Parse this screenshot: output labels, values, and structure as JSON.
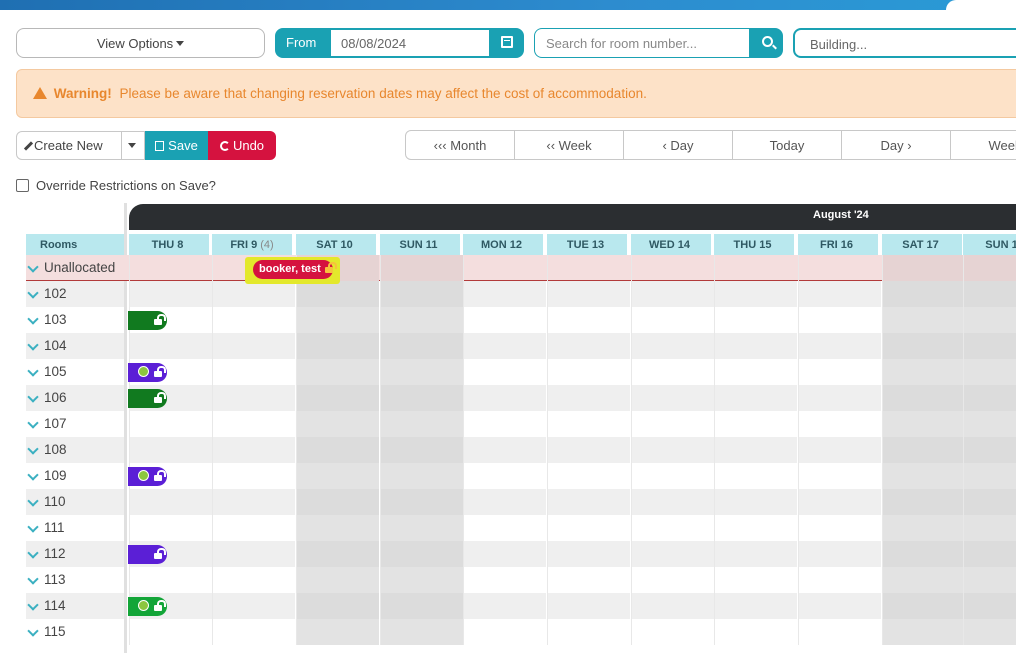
{
  "toolbar": {
    "view_options": "View Options",
    "from_label": "From",
    "from_date": "08/08/2024",
    "search_placeholder": "Search for room number...",
    "building_placeholder": "Building..."
  },
  "warning": {
    "title": "Warning!",
    "message": "Please be aware that changing reservation dates may affect the cost of accommodation."
  },
  "actions": {
    "create_new": "Create New",
    "save": "Save",
    "undo": "Undo"
  },
  "nav": [
    "‹‹‹ Month",
    "‹‹ Week",
    "‹ Day",
    "Today",
    "Day ›",
    "Week"
  ],
  "override_label": "Override Restrictions on Save?",
  "calendar": {
    "month_label": "August '24",
    "rooms_header": "Rooms",
    "days": [
      {
        "label": "THU 8",
        "count": ""
      },
      {
        "label": "FRI 9",
        "count": "(4)"
      },
      {
        "label": "SAT 10",
        "count": ""
      },
      {
        "label": "SUN 11",
        "count": ""
      },
      {
        "label": "MON 12",
        "count": ""
      },
      {
        "label": "TUE 13",
        "count": ""
      },
      {
        "label": "WED 14",
        "count": ""
      },
      {
        "label": "THU 15",
        "count": ""
      },
      {
        "label": "FRI 16",
        "count": ""
      },
      {
        "label": "SAT 17",
        "count": ""
      },
      {
        "label": "SUN 1",
        "count": ""
      }
    ],
    "rows": [
      {
        "label": "Unallocated",
        "booking": "booker, test"
      },
      {
        "label": "102"
      },
      {
        "label": "103"
      },
      {
        "label": "104"
      },
      {
        "label": "105"
      },
      {
        "label": "106"
      },
      {
        "label": "107"
      },
      {
        "label": "108"
      },
      {
        "label": "109"
      },
      {
        "label": "110"
      },
      {
        "label": "111"
      },
      {
        "label": "112"
      },
      {
        "label": "113"
      },
      {
        "label": "114"
      },
      {
        "label": "115"
      }
    ]
  },
  "colors": {
    "accent": "#1aa1b3",
    "danger": "#d5123f",
    "green_booking": "#117a1f",
    "purple_booking": "#5b1fd6",
    "bright_green_booking": "#13a538"
  },
  "icons": {
    "warning": "warning-triangle-icon",
    "calendar": "calendar-icon",
    "search": "search-icon",
    "lock": "unlock-icon",
    "chevron": "chevron-down-icon"
  }
}
